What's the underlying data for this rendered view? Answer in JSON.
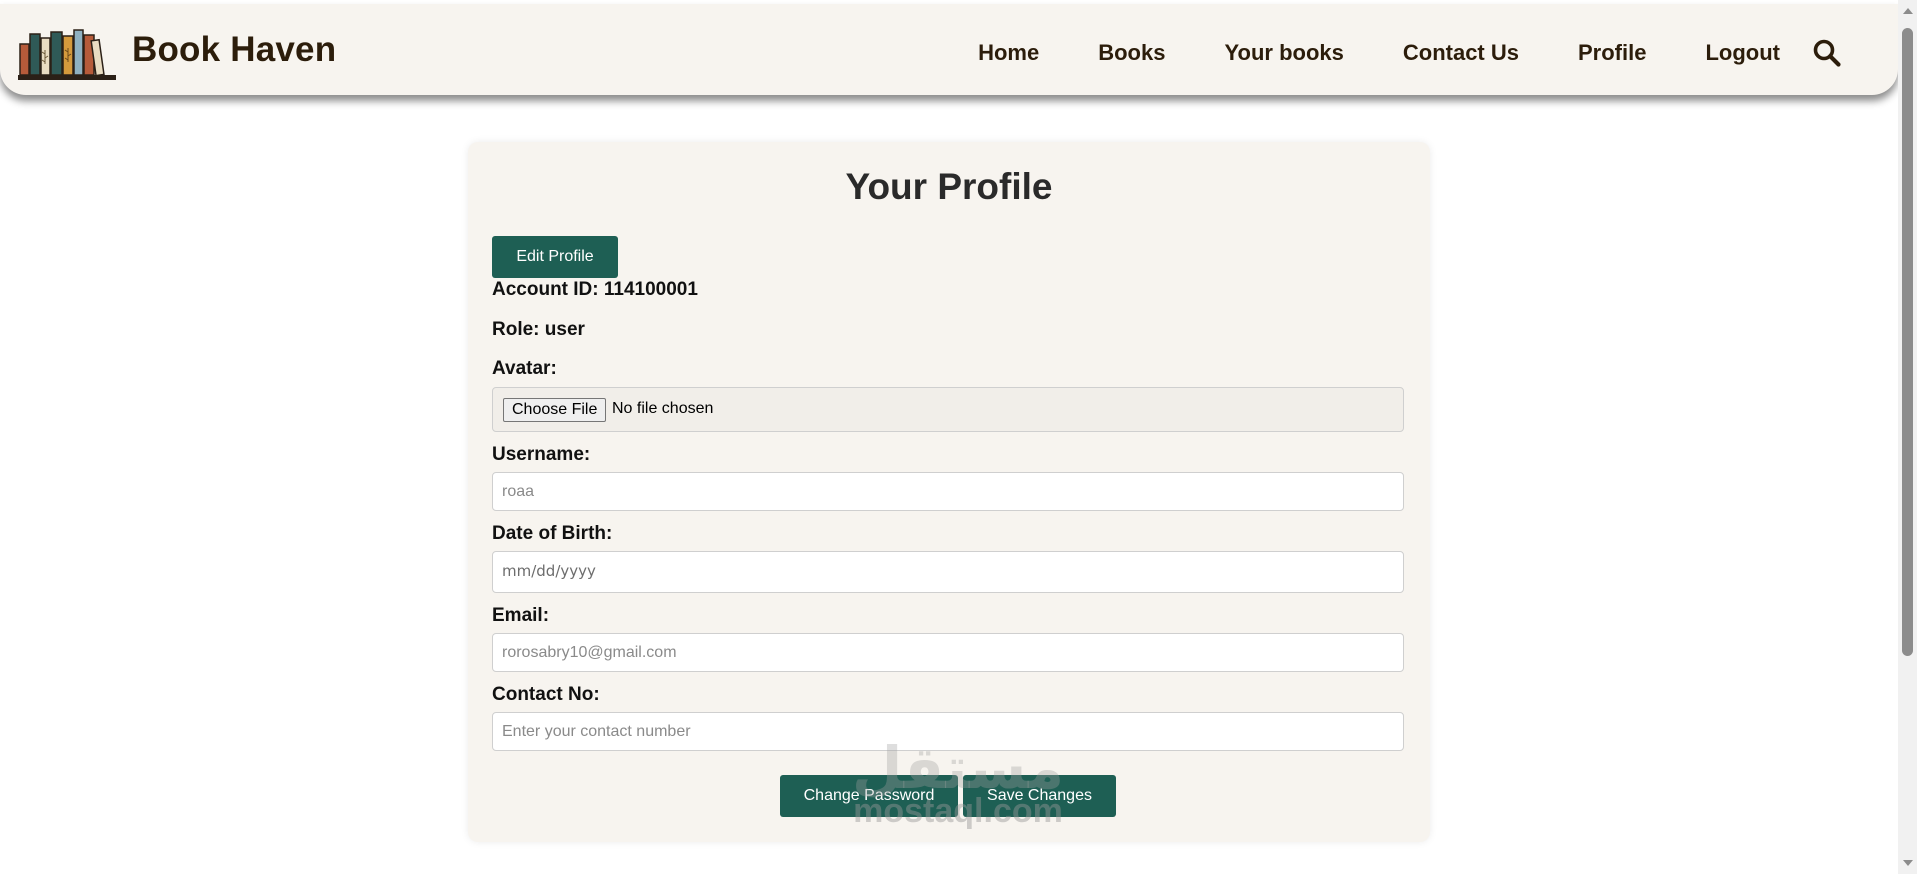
{
  "brand": {
    "name": "Book Haven",
    "logo_icon": "bookshelf-icon"
  },
  "nav": {
    "items": [
      {
        "label": "Home"
      },
      {
        "label": "Books"
      },
      {
        "label": "Your books"
      },
      {
        "label": "Contact Us"
      },
      {
        "label": "Profile"
      },
      {
        "label": "Logout"
      }
    ],
    "search_icon": "search-icon"
  },
  "profile": {
    "title": "Your Profile",
    "edit_button": "Edit Profile",
    "account_id_line": "Account ID: 114100001",
    "role_line": "Role: user",
    "avatar": {
      "label": "Avatar:",
      "choose_button": "Choose File",
      "status": "No file chosen"
    },
    "username": {
      "label": "Username:",
      "placeholder": "roaa"
    },
    "dob": {
      "label": "Date of Birth:",
      "placeholder": "mm/dd/yyyy"
    },
    "email": {
      "label": "Email:",
      "placeholder": "rorosabry10@gmail.com"
    },
    "contact": {
      "label": "Contact No:",
      "placeholder": "Enter your contact number"
    },
    "change_password_button": "Change Password",
    "save_button": "Save Changes"
  },
  "watermark": {
    "arabic": "مستقل",
    "latin": "mostaql.com"
  },
  "colors": {
    "accent": "#1e5f54",
    "header_bg": "#f7f4ef",
    "brand_text": "#2c1d0b"
  }
}
